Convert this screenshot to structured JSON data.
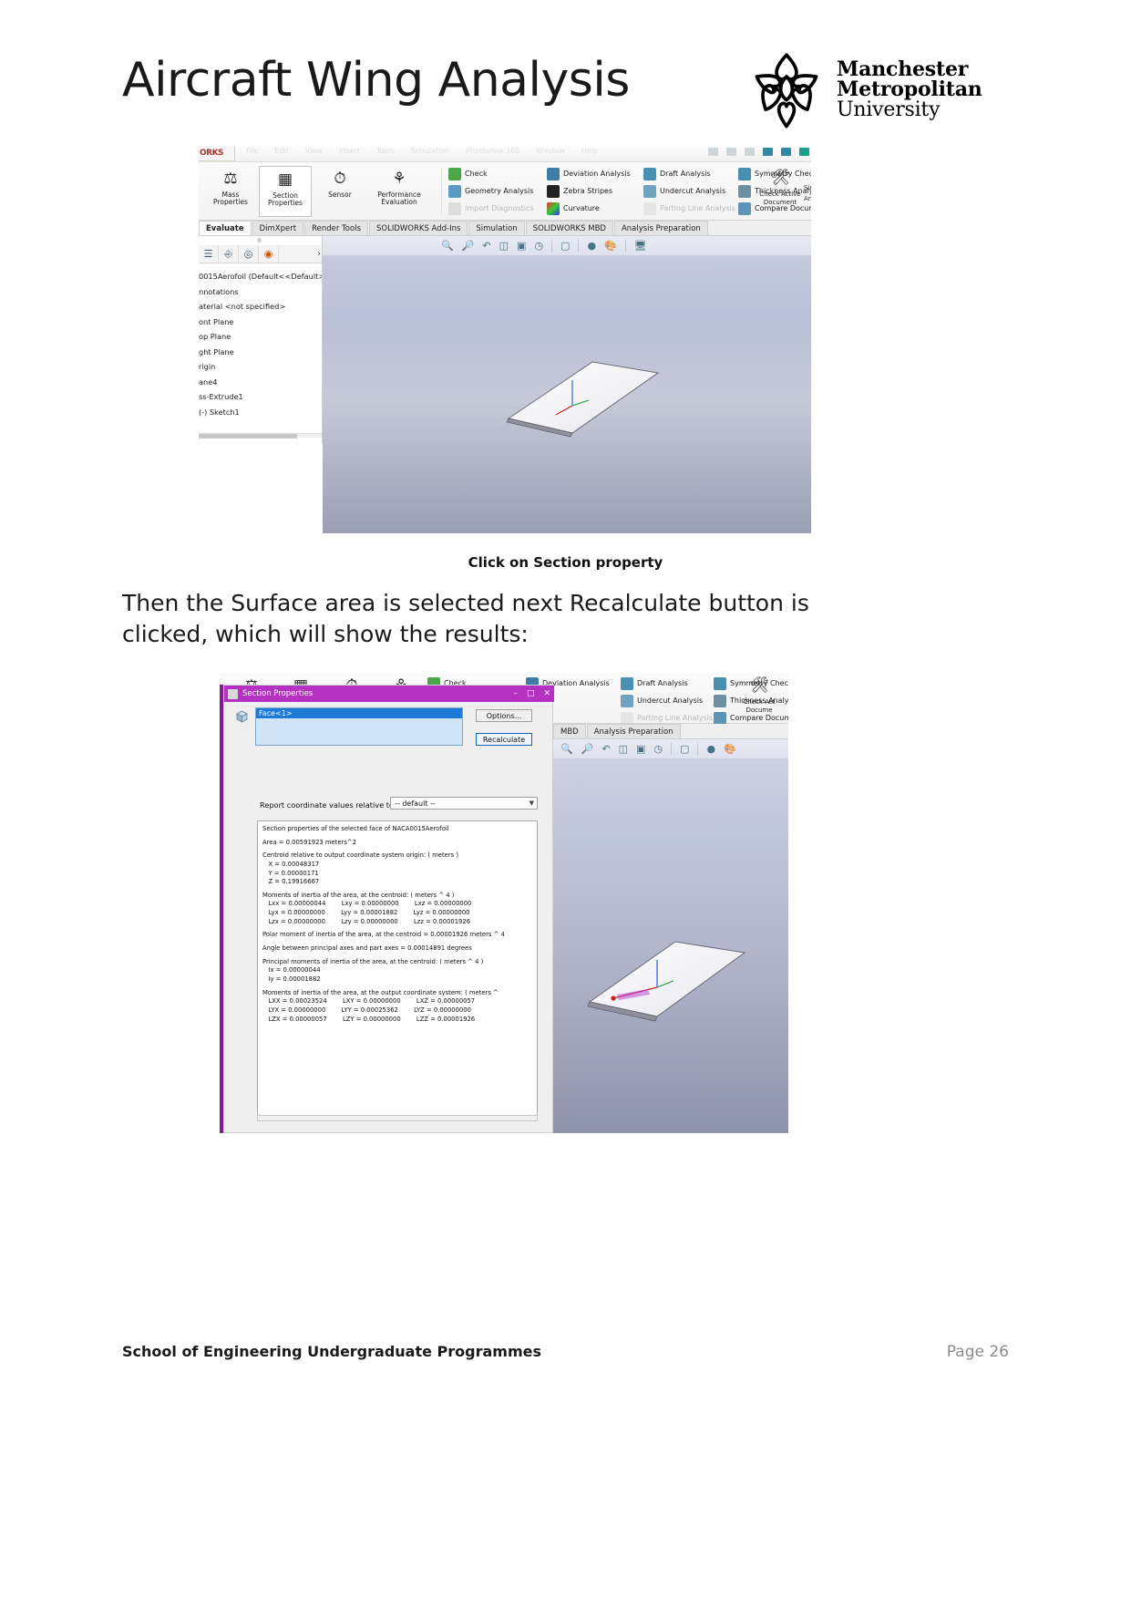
{
  "header": {
    "title": "Aircraft Wing Analysis",
    "logo": {
      "line1": "Manchester",
      "line2": "Metropolitan",
      "line3": "University",
      "mark_name": "mmu-flower-logo"
    }
  },
  "screenshot1": {
    "app_name": "SOLIDWORKS",
    "logo_tab": "ORKS",
    "menu": [
      "File",
      "Edit",
      "View",
      "Insert",
      "Tools",
      "Simulation",
      "Photoview 360",
      "Window",
      "Help"
    ],
    "ribbon_big": [
      {
        "label1": "Mass",
        "label2": "Properties",
        "icon": "mass-properties-icon",
        "selected": false
      },
      {
        "label1": "Section",
        "label2": "Properties",
        "icon": "section-properties-icon",
        "selected": true
      },
      {
        "label1": "Sensor",
        "label2": "",
        "icon": "sensor-icon",
        "selected": false
      },
      {
        "label1": "Performance",
        "label2": "Evaluation",
        "icon": "performance-evaluation-icon",
        "selected": false
      }
    ],
    "ribbon_col1": [
      {
        "label": "Check",
        "icon": "check-icon",
        "disabled": false
      },
      {
        "label": "Geometry Analysis",
        "icon": "geometry-analysis-icon",
        "disabled": false
      },
      {
        "label": "Import Diagnostics",
        "icon": "import-diagnostics-icon",
        "disabled": true
      }
    ],
    "ribbon_col2": [
      {
        "label": "Deviation Analysis",
        "icon": "deviation-analysis-icon",
        "disabled": false
      },
      {
        "label": "Zebra Stripes",
        "icon": "zebra-stripes-icon",
        "disabled": false
      },
      {
        "label": "Curvature",
        "icon": "curvature-icon",
        "disabled": false
      }
    ],
    "ribbon_col3": [
      {
        "label": "Draft Analysis",
        "icon": "draft-analysis-icon",
        "disabled": false
      },
      {
        "label": "Undercut Analysis",
        "icon": "undercut-analysis-icon",
        "disabled": false
      },
      {
        "label": "Parting Line Analysis",
        "icon": "parting-line-analysis-icon",
        "disabled": true
      }
    ],
    "ribbon_col4": [
      {
        "label": "Symmetry Check",
        "icon": "symmetry-check-icon",
        "disabled": false
      },
      {
        "label": "Thickness Analysis",
        "icon": "thickness-analysis-icon",
        "disabled": false
      },
      {
        "label": "Compare Documents",
        "icon": "compare-documents-icon",
        "disabled": false
      }
    ],
    "ribbon_right": {
      "label1": "Check Active",
      "label2": "Document",
      "icon": "check-active-document-icon",
      "partial_label1": "Sim",
      "partial_label2": "An"
    },
    "tabs": [
      "Evaluate",
      "DimXpert",
      "Render Tools",
      "SOLIDWORKS Add-Ins",
      "Simulation",
      "SOLIDWORKS MBD",
      "Analysis Preparation"
    ],
    "active_tab": "Evaluate",
    "tree": [
      "0015Aerofoil  (Default<<Default>",
      "nnotations",
      "aterial <not specified>",
      "ont Plane",
      "op Plane",
      "ght Plane",
      "rigin",
      "ane4",
      "ss-Extrude1",
      "  (-) Sketch1"
    ],
    "tree_toolbar_icons": [
      "feature-tree-icon",
      "property-manager-icon",
      "configuration-manager-icon",
      "display-manager-icon",
      "chevron-right-icon"
    ],
    "view_toolbar_icons": [
      "zoom-to-fit-icon",
      "zoom-to-area-icon",
      "previous-view-icon",
      "section-view-icon",
      "view-orientation-icon",
      "display-style-icon",
      "hide-show-icon",
      "edit-appearance-icon",
      "apply-scene-icon",
      "view-settings-icon"
    ]
  },
  "caption1": "Click on Section property",
  "paragraph1": "Then the Surface area is selected next Recalculate button is clicked, which will show the results:",
  "screenshot2": {
    "ribbon_col1": [
      {
        "label": "Check",
        "icon": "check-icon",
        "disabled": false
      },
      {
        "label": "",
        "icon": "geometry-analysis-icon",
        "disabled": false
      }
    ],
    "ribbon_col2": [
      {
        "label": "Deviation Analysis",
        "icon": "deviation-analysis-icon",
        "disabled": false
      },
      {
        "label": "",
        "icon": "zebra-stripes-icon",
        "disabled": false
      }
    ],
    "ribbon_col3": [
      {
        "label": "Draft Analysis",
        "icon": "draft-analysis-icon",
        "disabled": false
      },
      {
        "label": "Undercut Analysis",
        "icon": "undercut-analysis-icon",
        "disabled": false
      },
      {
        "label": "Parting Line Analysis",
        "icon": "parting-line-analysis-icon",
        "disabled": true
      }
    ],
    "ribbon_col4": [
      {
        "label": "Symmetry Check",
        "icon": "symmetry-check-icon",
        "disabled": false
      },
      {
        "label": "Thickness Analysis",
        "icon": "thickness-analysis-icon",
        "disabled": false
      },
      {
        "label": "Compare Documents",
        "icon": "compare-documents-icon",
        "disabled": false
      }
    ],
    "ribbon_right": {
      "label1": "Check Act",
      "label2": "Docume",
      "icon": "check-active-document-icon"
    },
    "tabs": [
      "MBD",
      "Analysis Preparation"
    ],
    "dialog": {
      "title": "Section Properties",
      "title_icon": "section-properties-icon",
      "minimize": "–",
      "maximize": "□",
      "close": "✕",
      "selection_icon": "face-cube-icon",
      "selection_value": "Face<1>",
      "options_button": "Options...",
      "recalculate_button": "Recalculate",
      "coord_label": "Report coordinate values relative to:",
      "coord_value": "-- default --",
      "results": [
        "Section properties of the selected face of NACA0015Aerofoil",
        "",
        "Area = 0.00591923 meters^2",
        "",
        "Centroid relative to output coordinate system origin: ( meters )",
        "   X = 0.00048317",
        "   Y = 0.00000171",
        "   Z = 0.19916667",
        "",
        "Moments of inertia of the area, at the centroid: ( meters ^ 4 )",
        "   Lxx = 0.00000044        Lxy = 0.00000000        Lxz = 0.00000000",
        "   Lyx = 0.00000000        Lyy = 0.00001882        Lyz = 0.00000000",
        "   Lzx = 0.00000000        Lzy = 0.00000000        Lzz = 0.00001926",
        "",
        "Polar moment of inertia of the area, at the centroid = 0.00001926 meters ^ 4",
        "",
        "Angle between principal axes and part axes = 0.00014891 degrees",
        "",
        "Principal moments of inertia of the area, at the centroid: ( meters ^ 4 )",
        "   Ix = 0.00000044",
        "   Iy = 0.00001882",
        "",
        "Moments of inertia of the area, at the output coordinate system: ( meters ^ ",
        "   LXX = 0.00023524        LXY = 0.00000000        LXZ = 0.00000057",
        "   LYX = 0.00000000        LYY = 0.00025362        LYZ = 0.00000000",
        "   LZX = 0.00000057        LZY = 0.00000000        LZZ = 0.00001926"
      ]
    }
  },
  "footer": {
    "left": "School of Engineering Undergraduate Programmes",
    "right": "Page 26"
  },
  "colors": {
    "dialog_title_bar": "#b531c2",
    "purple_strip": "#7d1f8f",
    "selection_highlight": "#1e7ad6",
    "footer_page": "#8b8b8b"
  }
}
